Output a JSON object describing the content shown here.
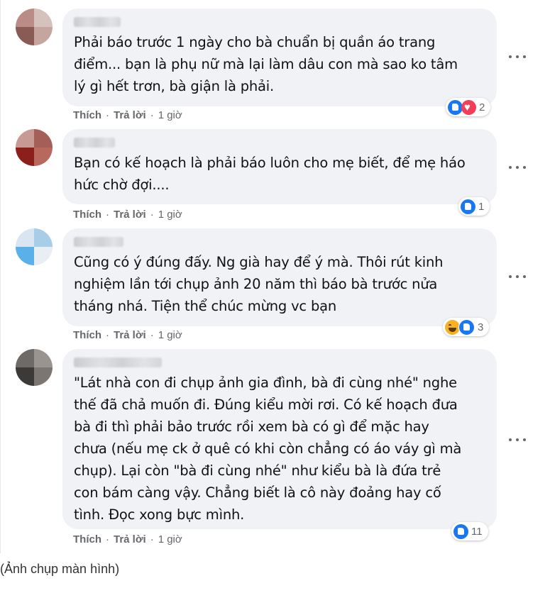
{
  "comments": [
    {
      "text": "Phải báo trước 1 ngày cho bà chuẩn bị quần áo trang\nđiểm... bạn là phụ nữ mà lại làm dâu con mà sao ko tâm\nlý gì hết trơn, bà giận là phải.",
      "like_label": "Thích",
      "reply_label": "Trả lời",
      "time": "1 giờ",
      "reaction_count": "2",
      "reactions": [
        "like-icon",
        "love-icon"
      ]
    },
    {
      "text": "Bạn có kế hoạch là phải báo luôn cho mẹ biết, để mẹ háo\nhức chờ đợi....",
      "like_label": "Thích",
      "reply_label": "Trả lời",
      "time": "1 giờ",
      "reaction_count": "1",
      "reactions": [
        "like-icon"
      ]
    },
    {
      "text": "Cũng có ý đúng đấy. Ng già hay để ý mà. Thôi rút kinh\nnghiệm lần tới chụp ảnh 20 năm thì báo bà trước nửa\ntháng nhá. Tiện thể chúc mừng vc bạn",
      "like_label": "Thích",
      "reply_label": "Trả lời",
      "time": "1 giờ",
      "reaction_count": "3",
      "reactions": [
        "haha-icon",
        "like-icon"
      ]
    },
    {
      "text": "\"Lát nhà con đi chụp ảnh gia đình, bà đi cùng nhé\" nghe\nthế đã chả muốn đi. Đúng kiểu mời rơi. Có kế hoạch đưa\nbà đi thì phải bảo trước rồi xem bà có gì để mặc hay\nchưa (nếu mẹ ck ở quê có khi còn chẳng có áo váy gì mà\nchụp). Lại còn \"bà đi cùng nhé\" như kiểu bà là đứa trẻ\ncon bám càng vậy. Chẳng biết là cô này đoảng hay cố\ntình. Đọc xong bực mình.",
      "like_label": "Thích",
      "reply_label": "Trả lời",
      "time": "1 giờ",
      "reaction_count": "11",
      "reactions": [
        "like-icon"
      ]
    }
  ],
  "separator": "·",
  "caption": "(Ảnh chụp màn hình)",
  "colors": {
    "bubble": "#f0f2f5",
    "meta": "#65676b",
    "like": "#1877f2",
    "love": "#f33e58",
    "haha": "#f7b125"
  }
}
